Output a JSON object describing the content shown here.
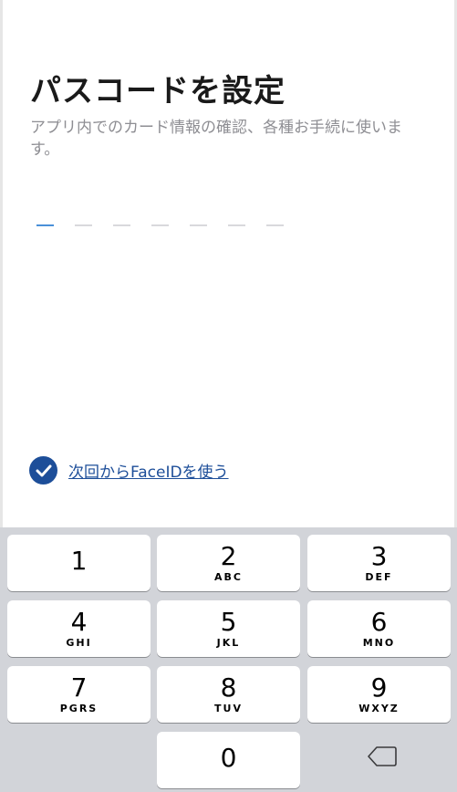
{
  "header": {
    "title": "パスコードを設定",
    "description": "アプリ内でのカード情報の確認、各種お手続に使います。"
  },
  "passcode": {
    "length": 7,
    "filled": 0
  },
  "faceid": {
    "checked": true,
    "label": "次回からFaceIDを使う"
  },
  "keypad": {
    "keys": [
      {
        "num": "1",
        "letters": ""
      },
      {
        "num": "2",
        "letters": "ABC"
      },
      {
        "num": "3",
        "letters": "DEF"
      },
      {
        "num": "4",
        "letters": "GHI"
      },
      {
        "num": "5",
        "letters": "JKL"
      },
      {
        "num": "6",
        "letters": "MNO"
      },
      {
        "num": "7",
        "letters": "PGRS"
      },
      {
        "num": "8",
        "letters": "TUV"
      },
      {
        "num": "9",
        "letters": "WXYZ"
      },
      {
        "num": "0",
        "letters": ""
      }
    ],
    "delete_icon": "delete-backspace-icon"
  },
  "colors": {
    "accent": "#1d4e99",
    "active_dash": "#4a90d9",
    "keyboard_bg": "#d2d4d9"
  }
}
